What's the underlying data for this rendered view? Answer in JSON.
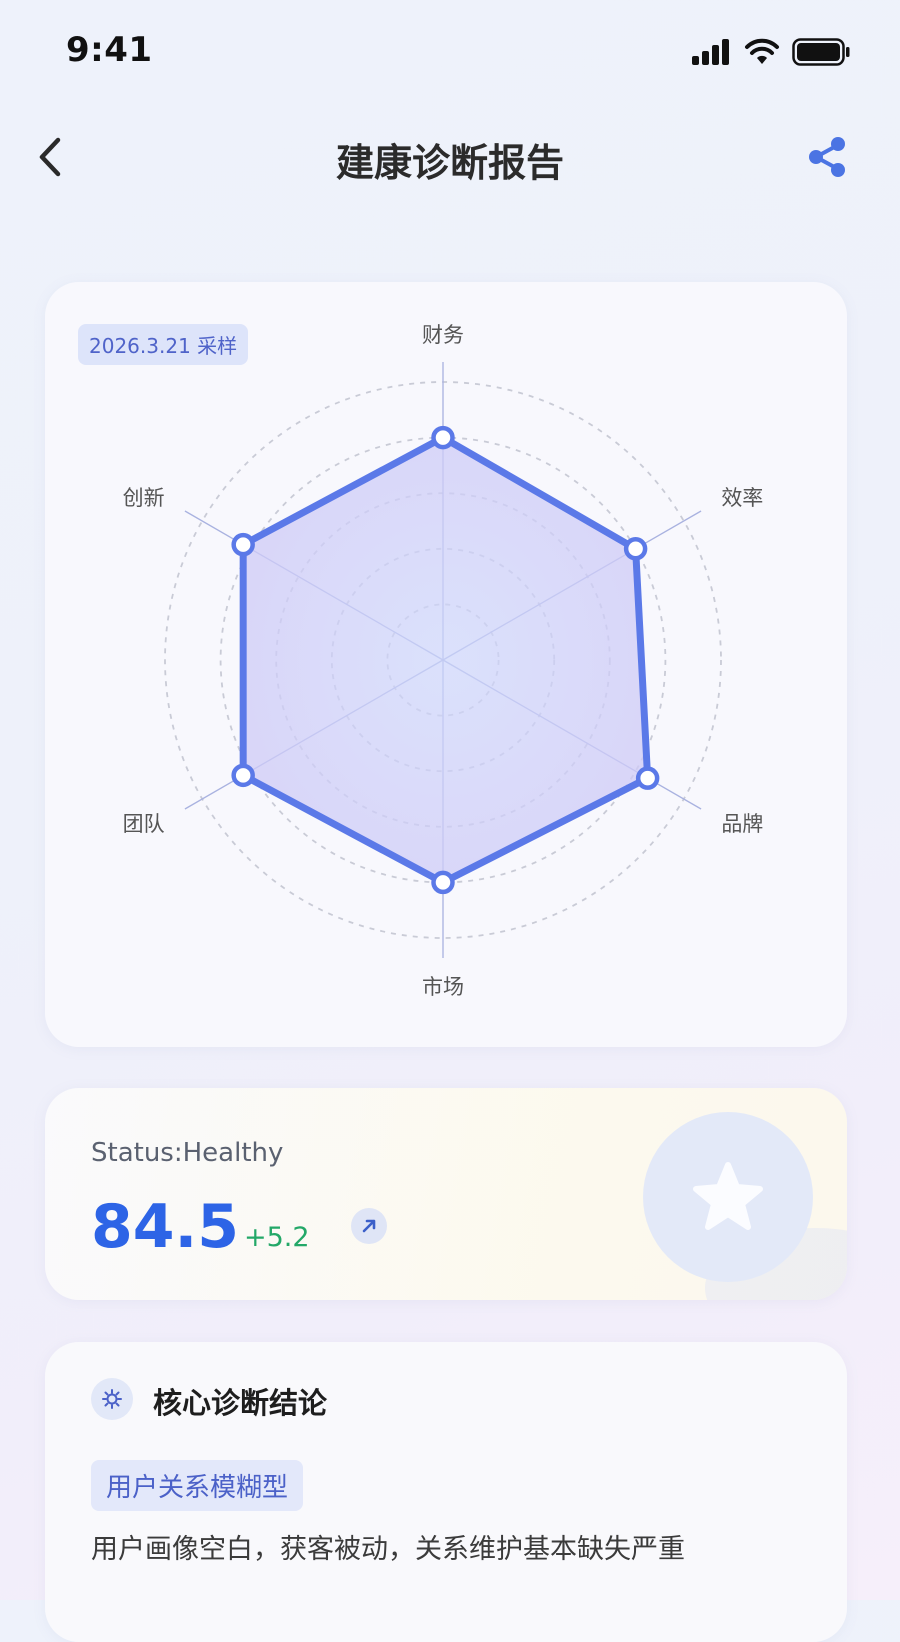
{
  "status_bar": {
    "time": "9:41"
  },
  "nav": {
    "title": "建康诊断报告"
  },
  "radar": {
    "sample_tag": "2026.3.21 采样",
    "axes": [
      "财务",
      "效率",
      "品牌",
      "市场",
      "团队",
      "创新"
    ],
    "chart_data": {
      "type": "radar",
      "categories": [
        "财务",
        "效率",
        "品牌",
        "市场",
        "团队",
        "创新"
      ],
      "values": [
        0.8,
        0.8,
        0.85,
        0.8,
        0.83,
        0.83
      ],
      "scale_max": 1,
      "rings": 5,
      "series_color": "#5b79e8",
      "fill_color": "#c9d2f8"
    }
  },
  "status": {
    "label": "Status:Healthy",
    "score": "84.5",
    "delta": "+5.2",
    "score_color": "#2d64e6",
    "delta_color": "#23a868"
  },
  "diagnosis": {
    "title": "核心诊断结论",
    "tag": "用户关系模糊型",
    "text": "用户画像空白，获客被动，关系维护基本缺失严重"
  },
  "icons": {
    "back": "chevron-left-icon",
    "share": "share-icon",
    "trend": "arrow-up-right-icon",
    "badge": "star-icon",
    "diagnosis": "bug-icon"
  }
}
